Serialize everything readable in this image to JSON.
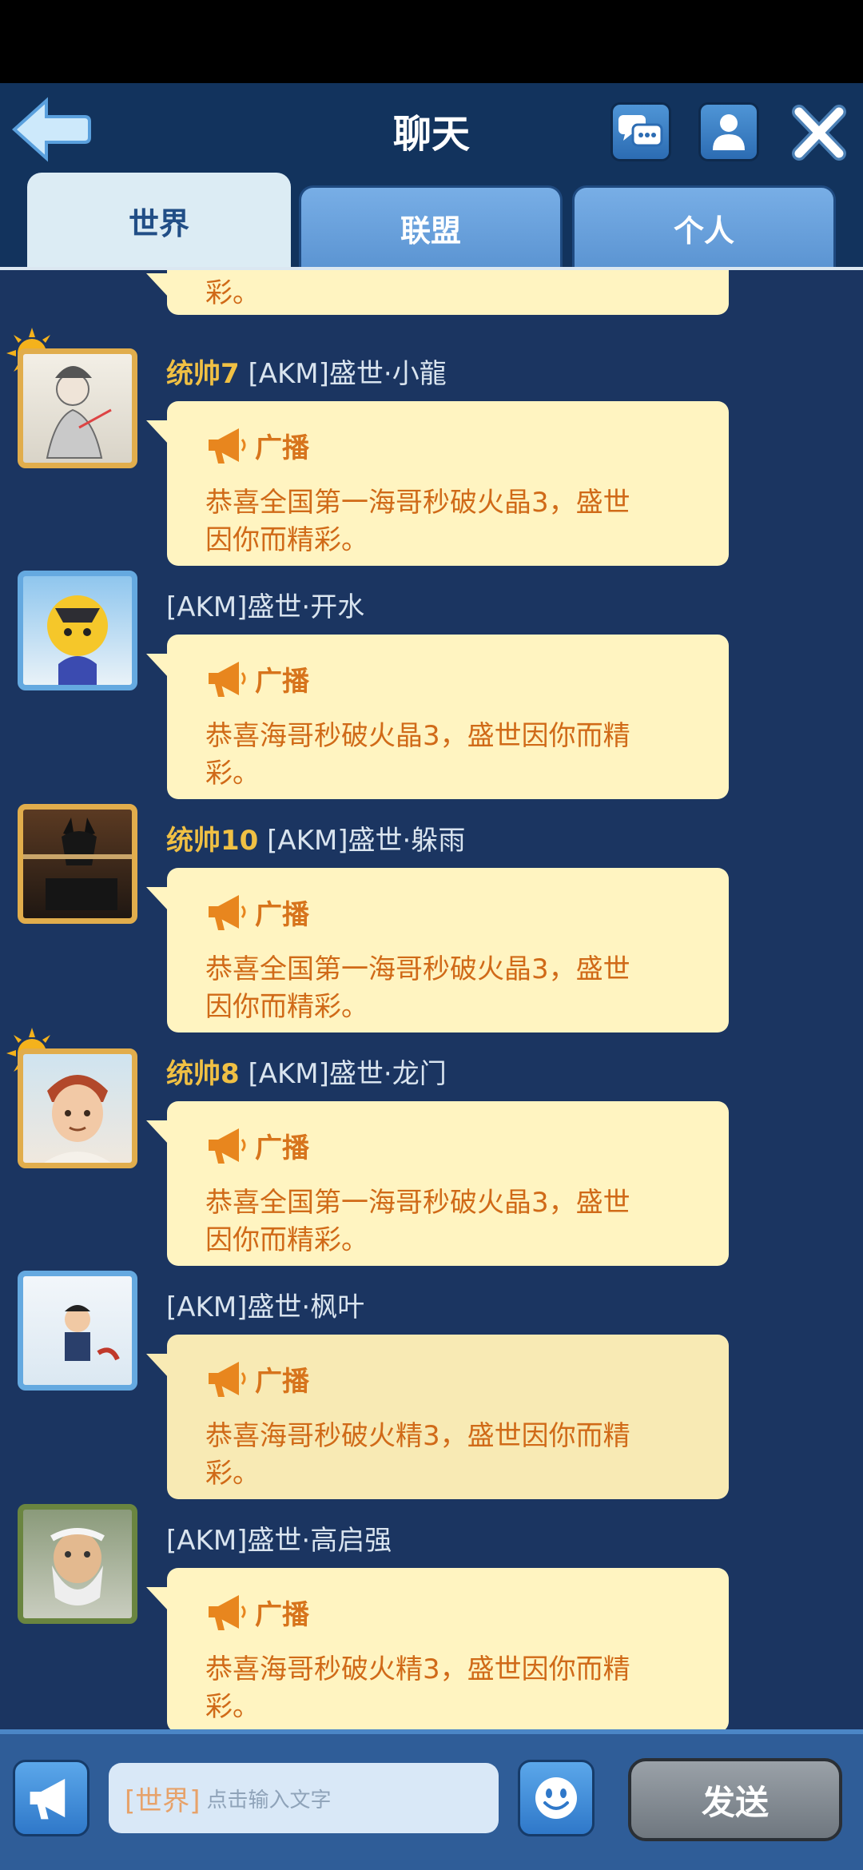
{
  "header": {
    "title": "聊天"
  },
  "tabs": [
    {
      "label": "世界",
      "active": true
    },
    {
      "label": "联盟",
      "active": false
    },
    {
      "label": "个人",
      "active": false
    }
  ],
  "top_partial": {
    "text": "彩。"
  },
  "messages": [
    {
      "rank": "统帅7",
      "name": "[AKM]盛世·小龍",
      "badge": "广播",
      "line1": "恭喜全国第一海哥秒破火晶3，盛世",
      "line2": "因你而精彩。"
    },
    {
      "rank": "",
      "name": "[AKM]盛世·开水",
      "badge": "广播",
      "line1": "恭喜海哥秒破火晶3，盛世因你而精",
      "line2": "彩。"
    },
    {
      "rank": "统帅10",
      "name": "[AKM]盛世·躲雨",
      "badge": "广播",
      "line1": "恭喜全国第一海哥秒破火晶3，盛世",
      "line2": "因你而精彩。"
    },
    {
      "rank": "统帅8",
      "name": "[AKM]盛世·龙门",
      "badge": "广播",
      "line1": "恭喜全国第一海哥秒破火晶3，盛世",
      "line2": "因你而精彩。"
    },
    {
      "rank": "",
      "name": "[AKM]盛世·枫叶",
      "badge": "广播",
      "line1": "恭喜海哥秒破火精3，盛世因你而精",
      "line2": "彩。"
    },
    {
      "rank": "",
      "name": "[AKM]盛世·高启强",
      "badge": "广播",
      "line1": "恭喜海哥秒破火精3，盛世因你而精",
      "line2": "彩。"
    }
  ],
  "input": {
    "channel": "[世界]",
    "placeholder": "点击输入文字"
  },
  "send_label": "发送",
  "colors": {
    "background": "#1b3561",
    "bubble": "#fff4c1",
    "message_text": "#d06a18",
    "rank": "#f0c044"
  }
}
